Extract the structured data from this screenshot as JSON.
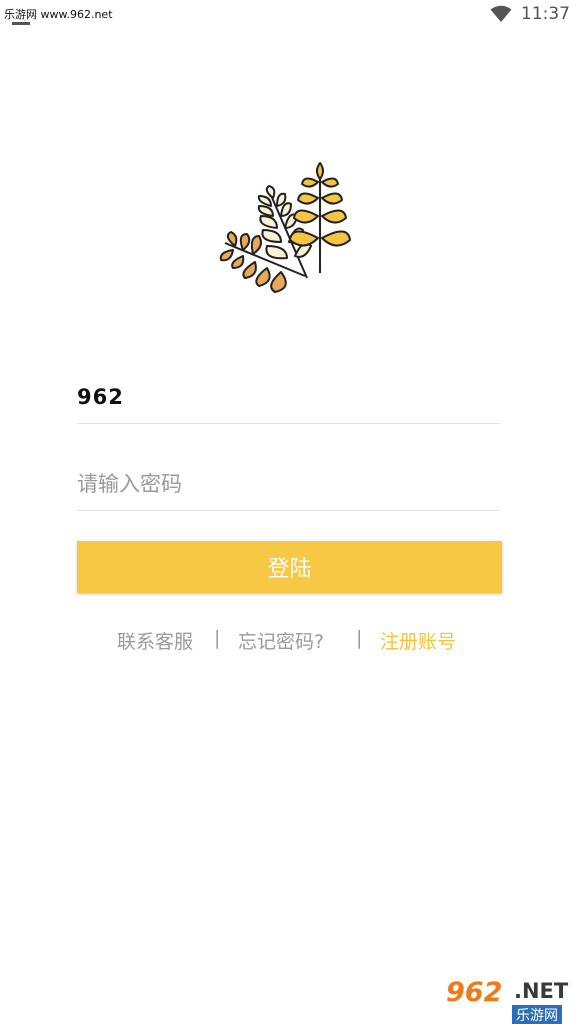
{
  "status_bar": {
    "watermark": "乐游网 www.962.net",
    "time": "11:37"
  },
  "form": {
    "username_value": "962",
    "password_placeholder": "请输入密码",
    "login_label": "登陆"
  },
  "links": {
    "customer_service": "联系客服",
    "separator": "|",
    "forgot_password": "忘记密码?",
    "register": "注册账号"
  },
  "watermark": {
    "number": "962",
    "domain": ".NET",
    "site_name": "乐游网"
  },
  "colors": {
    "accent": "#f7c843",
    "register_link": "#f3c53f",
    "muted_text": "#9a9a9a"
  },
  "icons": [
    "wifi-icon",
    "wheat-logo-icon"
  ]
}
